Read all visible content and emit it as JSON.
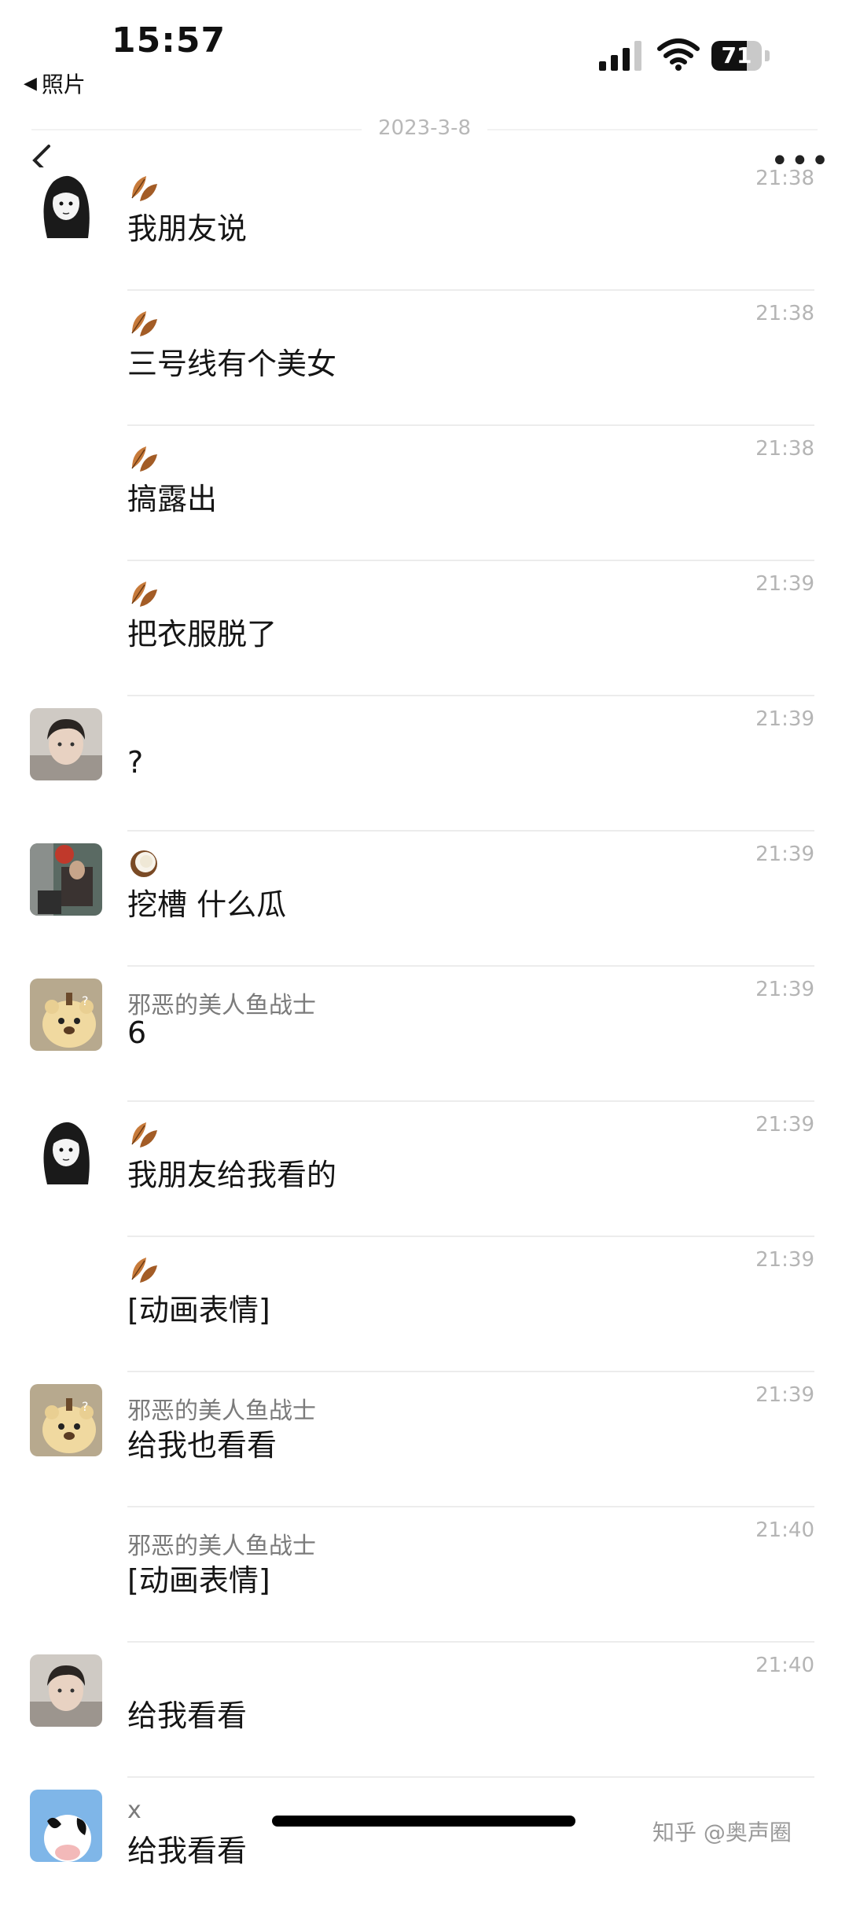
{
  "status_bar": {
    "time": "15:57",
    "back_app_label": "照片",
    "battery_level": "71",
    "battery_fraction": 0.71
  },
  "header": {
    "date": "2023-3-8",
    "back_icon": "chevron-left-icon",
    "more_icon": "more-dots-icon"
  },
  "messages": [
    {
      "avatar": "anime-girl",
      "label_type": "emoji",
      "emoji": "leaf",
      "sender": "",
      "text": "我朋友说",
      "time": "21:38"
    },
    {
      "avatar": "",
      "label_type": "emoji",
      "emoji": "leaf",
      "sender": "",
      "text": "三号线有个美女",
      "time": "21:38"
    },
    {
      "avatar": "",
      "label_type": "emoji",
      "emoji": "leaf",
      "sender": "",
      "text": "搞露出",
      "time": "21:38"
    },
    {
      "avatar": "",
      "label_type": "emoji",
      "emoji": "leaf",
      "sender": "",
      "text": "把衣服脱了",
      "time": "21:39"
    },
    {
      "avatar": "person",
      "label_type": "none",
      "emoji": "",
      "sender": "",
      "text": "?",
      "time": "21:39"
    },
    {
      "avatar": "photo",
      "label_type": "emoji",
      "emoji": "coconut",
      "sender": "",
      "text": "挖槽 什么瓜",
      "time": "21:39"
    },
    {
      "avatar": "bear",
      "label_type": "name",
      "emoji": "",
      "sender": "邪恶的美人鱼战士",
      "text": "6",
      "time": "21:39"
    },
    {
      "avatar": "anime-girl",
      "label_type": "emoji",
      "emoji": "leaf",
      "sender": "",
      "text": "我朋友给我看的",
      "time": "21:39"
    },
    {
      "avatar": "",
      "label_type": "emoji",
      "emoji": "leaf",
      "sender": "",
      "text": "[动画表情]",
      "time": "21:39"
    },
    {
      "avatar": "bear",
      "label_type": "name",
      "emoji": "",
      "sender": "邪恶的美人鱼战士",
      "text": "给我也看看",
      "time": "21:39"
    },
    {
      "avatar": "",
      "label_type": "name",
      "emoji": "",
      "sender": "邪恶的美人鱼战士",
      "text": "[动画表情]",
      "time": "21:40"
    },
    {
      "avatar": "person",
      "label_type": "none",
      "emoji": "",
      "sender": "",
      "text": "给我看看",
      "time": "21:40"
    },
    {
      "avatar": "cow",
      "label_type": "name",
      "emoji": "",
      "sender": "x",
      "text": "给我看看",
      "time": ""
    }
  ],
  "watermark": "知乎 @奥声圈"
}
